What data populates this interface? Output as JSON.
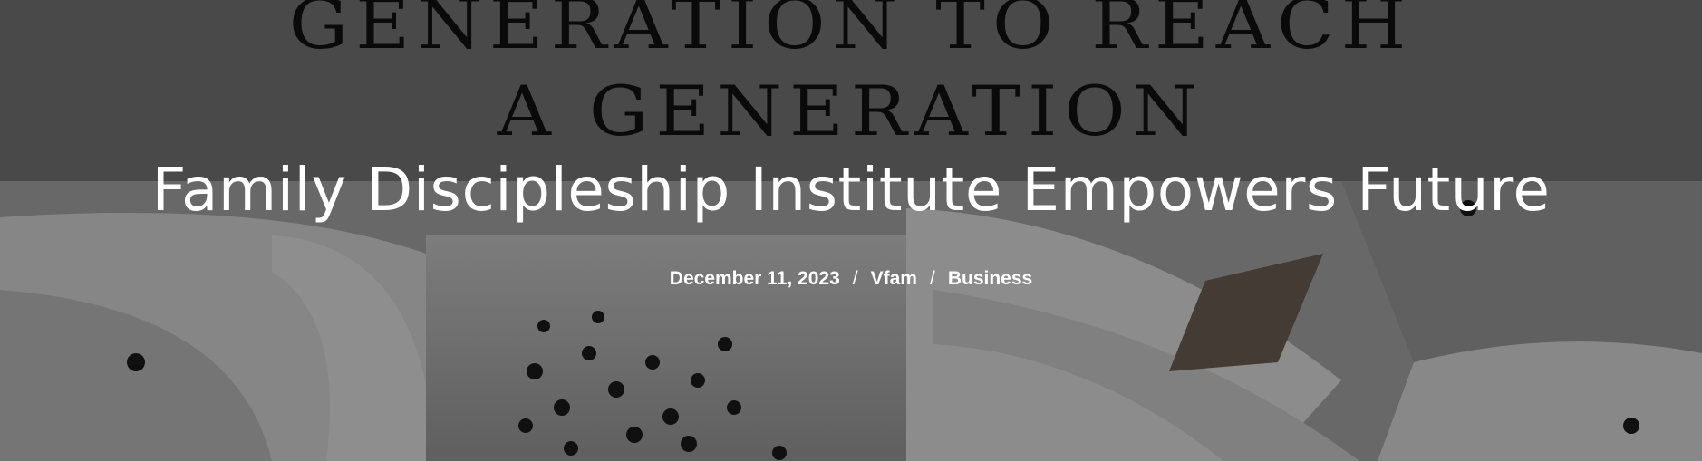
{
  "hero": {
    "image_text_line1": "GENERATION TO REACH",
    "image_text_line2": "A GENERATION",
    "title": "Family Discipleship Institute Empowers Future",
    "meta": {
      "date": "December 11, 2023",
      "separator": "/",
      "author": "Vfam",
      "category": "Business"
    }
  }
}
